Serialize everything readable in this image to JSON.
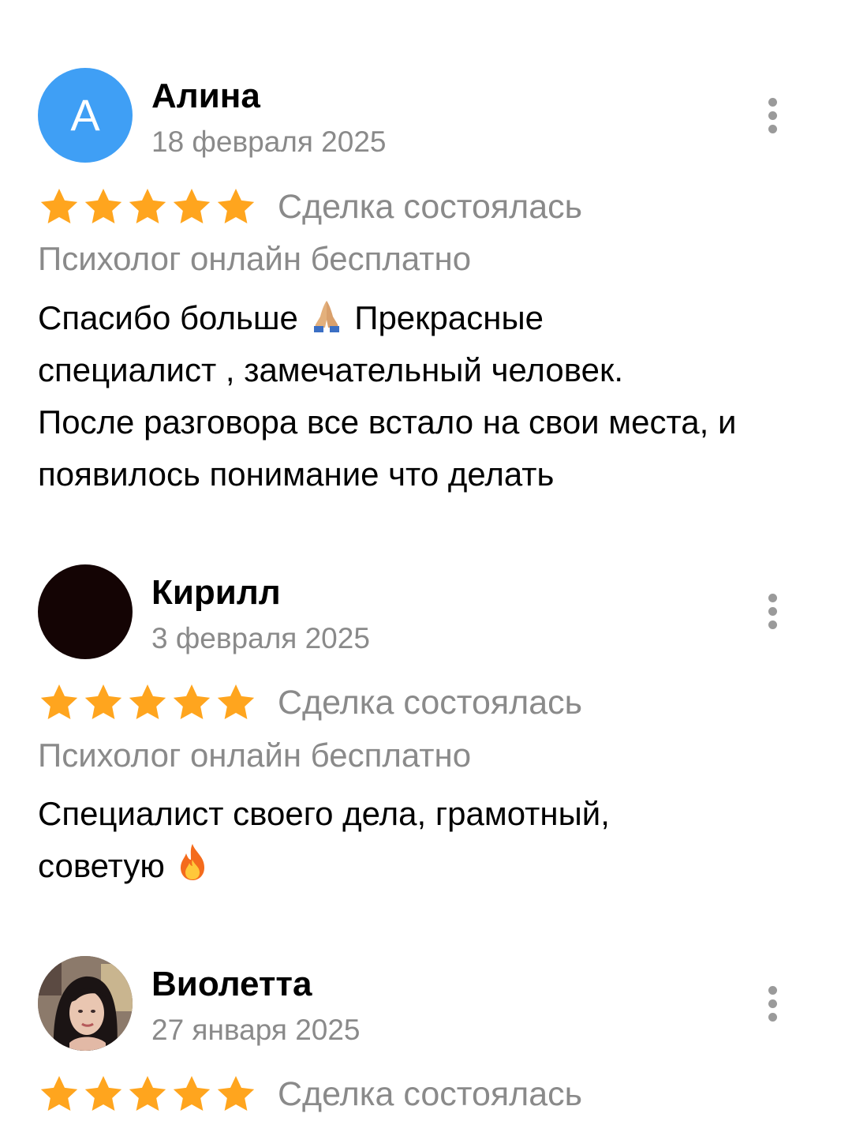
{
  "reviews": [
    {
      "author": "Алина",
      "avatar_letter": "А",
      "avatar_color": "#3f9ff5",
      "date": "18 февраля 2025",
      "rating": 5,
      "deal_status": "Сделка состоялась",
      "service": "Психолог онлайн бесплатно",
      "text_line1_a": "Спасибо больше",
      "text_line1_b": "Прекрасные",
      "text_line2": "специалист , замечательный человек.",
      "text_line3": "После разговора все встало на свои места, и",
      "text_line4": "появилось понимание что делать"
    },
    {
      "author": "Кирилл",
      "avatar_color": "#140404",
      "date": "3 февраля 2025",
      "rating": 5,
      "deal_status": "Сделка состоялась",
      "service": "Психолог онлайн бесплатно",
      "text_line1": "Специалист своего дела, грамотный,",
      "text_line2": "советую"
    },
    {
      "author": "Виолетта",
      "avatar_type": "photo",
      "date": "27 января 2025",
      "rating": 5,
      "deal_status": "Сделка состоялась"
    }
  ],
  "colors": {
    "star": "#ffa51e",
    "secondary_text": "#8a8a8a",
    "primary_text": "#000000",
    "more_dots": "#9a9a9a"
  },
  "icons": {
    "more": "more-vertical-icon",
    "star": "star-icon",
    "pray_emoji": "folded-hands-emoji",
    "fire_emoji": "fire-emoji"
  }
}
